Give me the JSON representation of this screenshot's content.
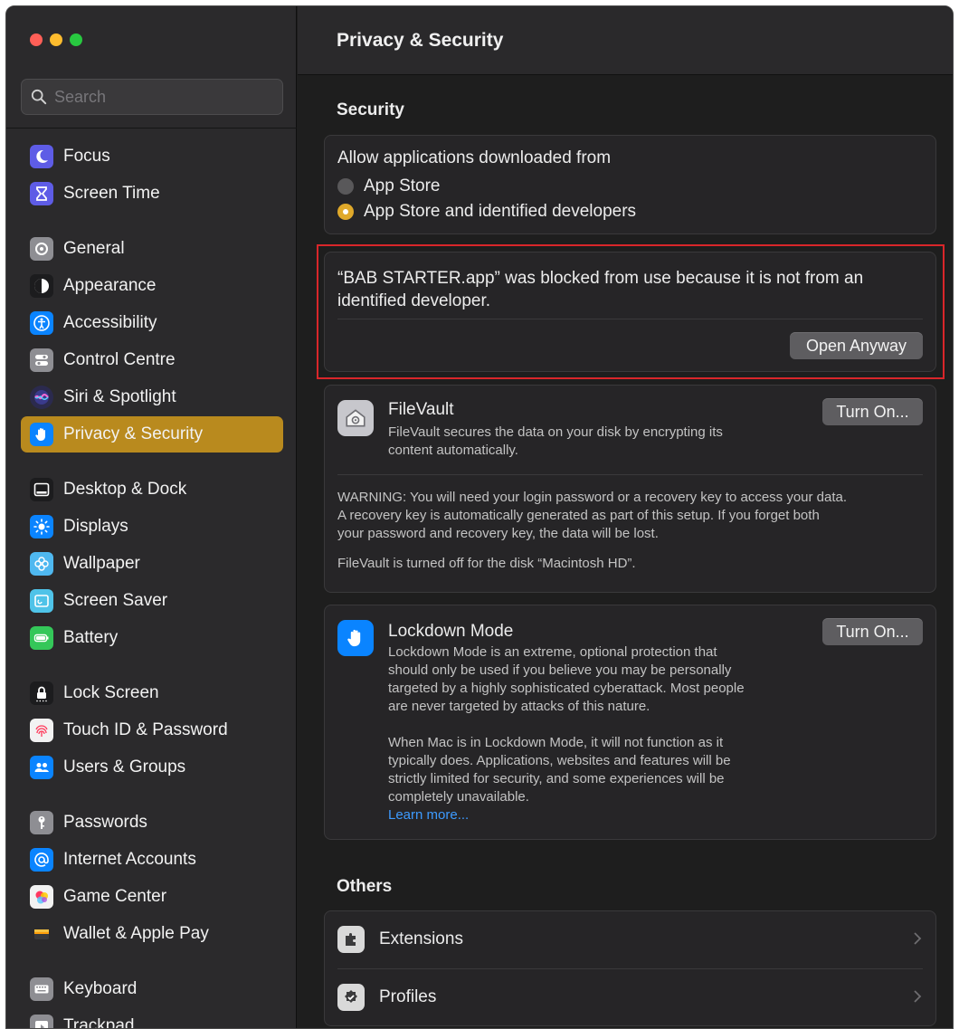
{
  "window": {
    "title": "Privacy & Security"
  },
  "search": {
    "placeholder": "Search"
  },
  "sidebar": {
    "items": [
      {
        "label": "Focus",
        "icon": "moon-icon",
        "color": "#5e5ce6"
      },
      {
        "label": "Screen Time",
        "icon": "hourglass-icon",
        "color": "#5e5ce6"
      },
      {
        "label": "General",
        "icon": "gear-icon",
        "color": "#8e8e93"
      },
      {
        "label": "Appearance",
        "icon": "appearance-icon",
        "color": "#1c1c1e"
      },
      {
        "label": "Accessibility",
        "icon": "accessibility-icon",
        "color": "#0a84ff"
      },
      {
        "label": "Control Centre",
        "icon": "control-centre-icon",
        "color": "#8e8e93"
      },
      {
        "label": "Siri & Spotlight",
        "icon": "siri-icon",
        "color": "#3a3a8c"
      },
      {
        "label": "Privacy & Security",
        "icon": "hand-icon",
        "color": "#0a84ff",
        "active": true
      },
      {
        "label": "Desktop & Dock",
        "icon": "dock-icon",
        "color": "#1c1c1e"
      },
      {
        "label": "Displays",
        "icon": "sun-icon",
        "color": "#0a84ff"
      },
      {
        "label": "Wallpaper",
        "icon": "flower-icon",
        "color": "#4fb8f0"
      },
      {
        "label": "Screen Saver",
        "icon": "screen-saver-icon",
        "color": "#4fc3e8"
      },
      {
        "label": "Battery",
        "icon": "battery-icon",
        "color": "#34c759"
      },
      {
        "label": "Lock Screen",
        "icon": "lock-icon",
        "color": "#1c1c1e"
      },
      {
        "label": "Touch ID & Password",
        "icon": "fingerprint-icon",
        "color": "#f2f2f2"
      },
      {
        "label": "Users & Groups",
        "icon": "users-icon",
        "color": "#0a84ff"
      },
      {
        "label": "Passwords",
        "icon": "key-icon",
        "color": "#8e8e93"
      },
      {
        "label": "Internet Accounts",
        "icon": "at-icon",
        "color": "#0a84ff"
      },
      {
        "label": "Game Center",
        "icon": "game-center-icon",
        "color": "#f2f2f2"
      },
      {
        "label": "Wallet & Apple Pay",
        "icon": "wallet-icon",
        "color": "#1c1c1e"
      },
      {
        "label": "Keyboard",
        "icon": "keyboard-icon",
        "color": "#8e8e93"
      },
      {
        "label": "Trackpad",
        "icon": "trackpad-icon",
        "color": "#8e8e93"
      }
    ]
  },
  "security": {
    "heading": "Security",
    "allow_label": "Allow applications downloaded from",
    "options": [
      {
        "label": "App Store",
        "selected": false
      },
      {
        "label": "App Store and identified developers",
        "selected": true
      }
    ],
    "blocked_message_line1": "“BAB STARTER.app” was blocked from use because it is not from an",
    "blocked_message_line2": "identified developer.",
    "open_anyway_label": "Open Anyway"
  },
  "filevault": {
    "title": "FileVault",
    "desc_line1": "FileVault secures the data on your disk by encrypting its",
    "desc_line2": "content automatically.",
    "button": "Turn On...",
    "warning_line1": "WARNING: You will need your login password or a recovery key to access your data.",
    "warning_line2": "A recovery key is automatically generated as part of this setup. If you forget both",
    "warning_line3": "your password and recovery key, the data will be lost.",
    "status": "FileVault is turned off for the disk “Macintosh HD”."
  },
  "lockdown": {
    "title": "Lockdown Mode",
    "button": "Turn On...",
    "p1_line1": "Lockdown Mode is an extreme, optional protection that",
    "p1_line2": "should only be used if you believe you may be personally",
    "p1_line3": "targeted by a highly sophisticated cyberattack. Most people",
    "p1_line4": "are never targeted by attacks of this nature.",
    "p2_line1": "When Mac is in Lockdown Mode, it will not function as it",
    "p2_line2": "typically does. Applications, websites and features will be",
    "p2_line3": "strictly limited for security, and some experiences will be",
    "p2_line4": "completely unavailable.",
    "learn_more": "Learn more..."
  },
  "others": {
    "heading": "Others",
    "items": [
      {
        "label": "Extensions",
        "icon": "extensions-icon"
      },
      {
        "label": "Profiles",
        "icon": "profiles-icon"
      }
    ]
  },
  "colors": {
    "accent_sidebar": "#b98a1e",
    "radio_selected": "#e0a92a",
    "highlight_border": "#d9262a",
    "link": "#3d9bff"
  }
}
